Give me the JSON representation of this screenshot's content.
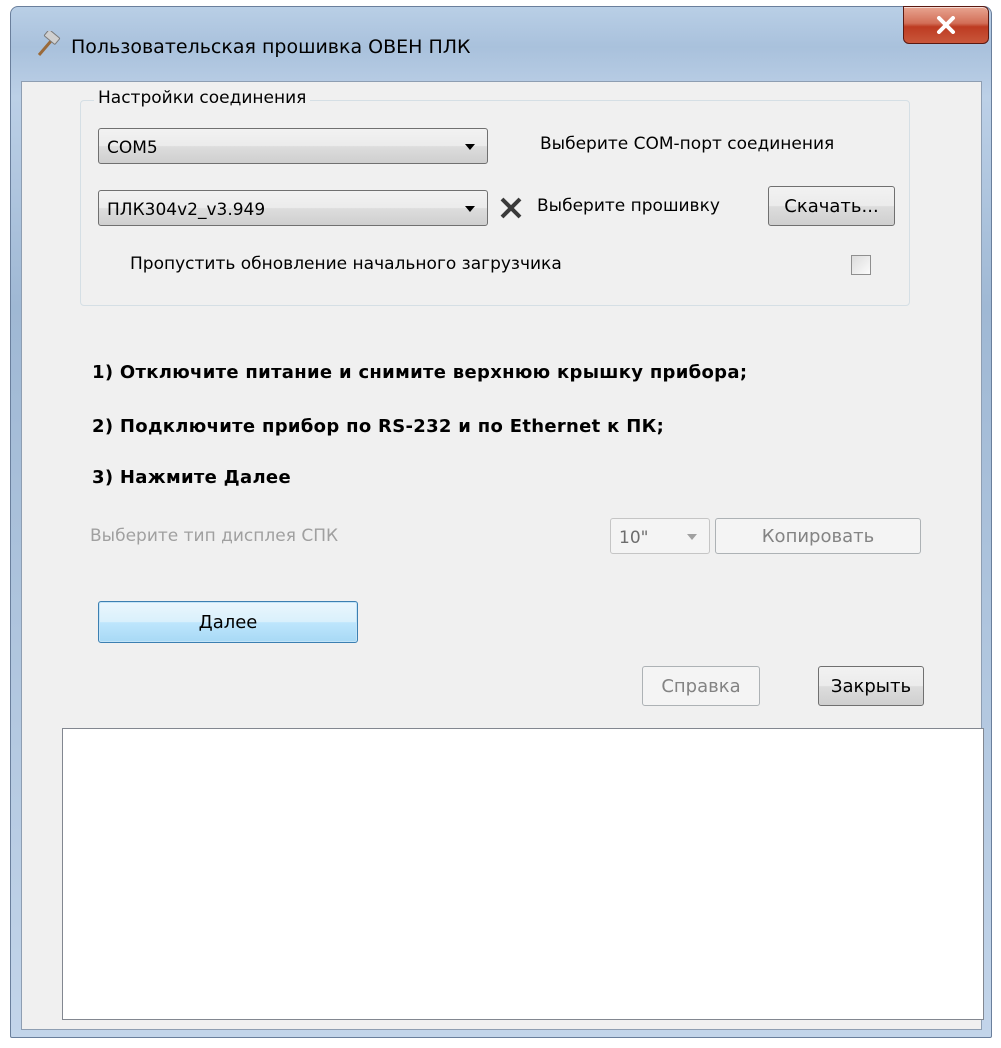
{
  "window": {
    "title": "Пользовательская прошивка ОВЕН ПЛК"
  },
  "connection": {
    "group_label": "Настройки соединения",
    "com_port": {
      "value": "COM5",
      "label": "Выберите COM-порт соединения"
    },
    "firmware": {
      "value": "ПЛК304v2_v3.949",
      "label": "Выберите прошивку",
      "download_label": "Скачать..."
    },
    "skip_bootloader": {
      "label": "Пропустить обновление начального загрузчика",
      "checked": false
    }
  },
  "instructions": [
    "1) Отключите питание и снимите верхнюю крышку прибора;",
    "2) Подключите прибор по RS-232 и по Ethernet к ПК;",
    "3) Нажмите Далее"
  ],
  "display": {
    "label": "Выберите тип дисплея СПК",
    "value": "10\"",
    "copy_label": "Копировать"
  },
  "buttons": {
    "next": "Далее",
    "help": "Справка",
    "close": "Закрыть"
  },
  "log": {
    "content": ""
  },
  "icons": {
    "app": "hammer-icon",
    "close": "close-icon",
    "clear": "clear-x-icon"
  },
  "colors": {
    "close_button": "#c9573b",
    "primary_button": "#a7d9f5",
    "disabled_text": "#a0a0a0"
  }
}
